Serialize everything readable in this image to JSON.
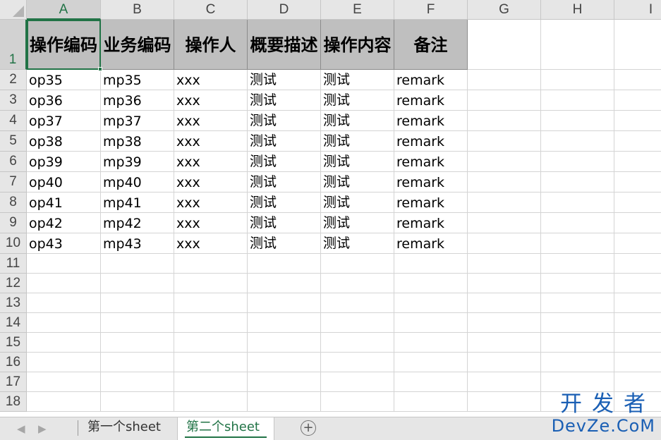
{
  "columns": [
    "A",
    "B",
    "C",
    "D",
    "E",
    "F",
    "G",
    "H",
    "I"
  ],
  "rows": [
    "1",
    "2",
    "3",
    "4",
    "5",
    "6",
    "7",
    "8",
    "9",
    "10",
    "11",
    "12",
    "13",
    "14",
    "15",
    "16",
    "17",
    "18"
  ],
  "header_cells": [
    "操作编码",
    "业务编码",
    "操作人",
    "概要描述",
    "操作内容",
    "备注"
  ],
  "data_rows": [
    [
      "op35",
      "mp35",
      "xxx",
      "测试",
      "测试",
      "remark"
    ],
    [
      "op36",
      "mp36",
      "xxx",
      "测试",
      "测试",
      "remark"
    ],
    [
      "op37",
      "mp37",
      "xxx",
      "测试",
      "测试",
      "remark"
    ],
    [
      "op38",
      "mp38",
      "xxx",
      "测试",
      "测试",
      "remark"
    ],
    [
      "op39",
      "mp39",
      "xxx",
      "测试",
      "测试",
      "remark"
    ],
    [
      "op40",
      "mp40",
      "xxx",
      "测试",
      "测试",
      "remark"
    ],
    [
      "op41",
      "mp41",
      "xxx",
      "测试",
      "测试",
      "remark"
    ],
    [
      "op42",
      "mp42",
      "xxx",
      "测试",
      "测试",
      "remark"
    ],
    [
      "op43",
      "mp43",
      "xxx",
      "测试",
      "测试",
      "remark"
    ]
  ],
  "active_cell": "A1",
  "sheet_tabs": [
    {
      "label": "第一个sheet",
      "active": false
    },
    {
      "label": "第二个sheet",
      "active": true
    }
  ],
  "watermark": {
    "cn": "开发者",
    "en": "DevZe.CoM"
  },
  "icons": {
    "prev": "chevron-left-icon",
    "next": "chevron-right-icon",
    "add": "plus-circle-icon"
  },
  "colors": {
    "accent": "#217346",
    "header_fill": "#bfbfbf",
    "watermark": "#1a5fb4"
  }
}
